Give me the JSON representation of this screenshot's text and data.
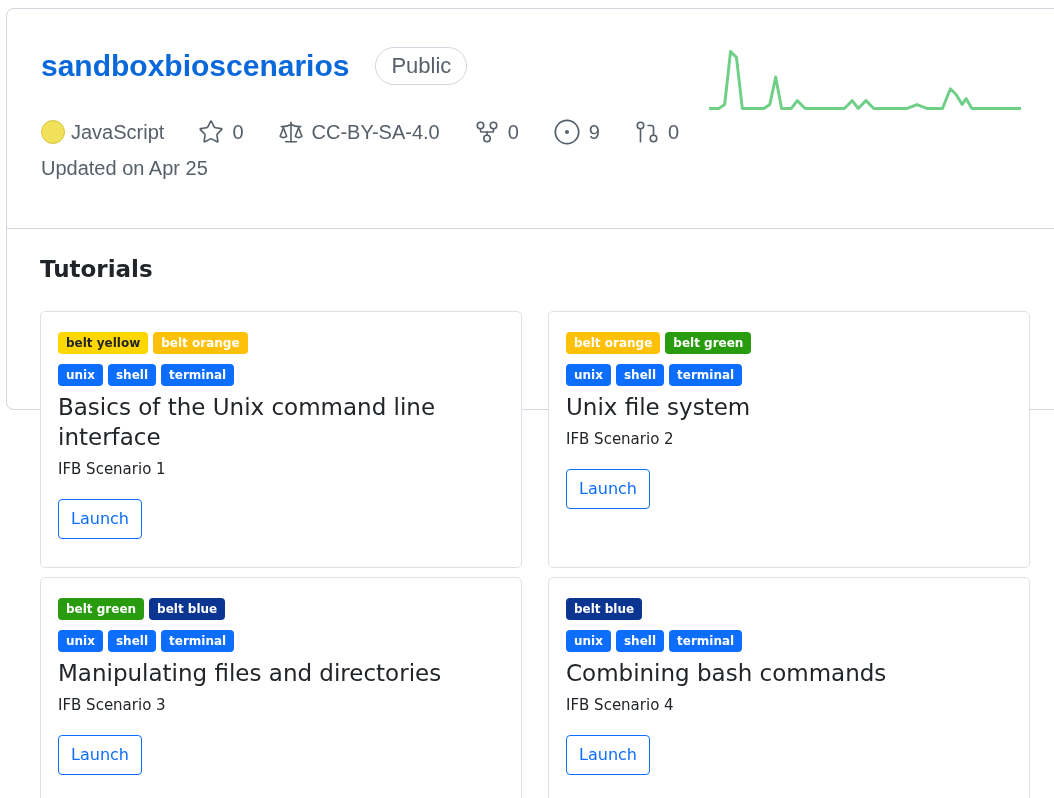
{
  "repo": {
    "name": "sandboxbioscenarios",
    "visibility": "Public",
    "language": {
      "name": "JavaScript",
      "color": "#f1e05a"
    },
    "stars": "0",
    "license": "CC-BY-SA-4.0",
    "forks": "0",
    "issues": "9",
    "pull_requests": "0",
    "updated": "Updated on Apr 25"
  },
  "tutorials": {
    "heading": "Tutorials",
    "cards": [
      {
        "tags": [
          [
            {
              "label": "belt yellow",
              "color": "#ffd700",
              "kind": "dark"
            },
            {
              "label": "belt orange",
              "color": "#ffc107",
              "kind": "light"
            }
          ],
          [
            {
              "label": "unix",
              "color": "#0d6efd",
              "kind": "light"
            },
            {
              "label": "shell",
              "color": "#0d6efd",
              "kind": "light"
            },
            {
              "label": "terminal",
              "color": "#0d6efd",
              "kind": "light"
            }
          ]
        ],
        "title": "Basics of the Unix command line interface",
        "subtitle": "IFB Scenario 1",
        "button": "Launch"
      },
      {
        "tags": [
          [
            {
              "label": "belt orange",
              "color": "#ffc107",
              "kind": "light"
            },
            {
              "label": "belt green",
              "color": "#289c0e",
              "kind": "light"
            }
          ],
          [
            {
              "label": "unix",
              "color": "#0d6efd",
              "kind": "light"
            },
            {
              "label": "shell",
              "color": "#0d6efd",
              "kind": "light"
            },
            {
              "label": "terminal",
              "color": "#0d6efd",
              "kind": "light"
            }
          ]
        ],
        "title": "Unix file system",
        "subtitle": "IFB Scenario 2",
        "button": "Launch"
      },
      {
        "tags": [
          [
            {
              "label": "belt green",
              "color": "#289c0e",
              "kind": "light"
            },
            {
              "label": "belt blue",
              "color": "#0b3591",
              "kind": "light"
            }
          ],
          [
            {
              "label": "unix",
              "color": "#0d6efd",
              "kind": "light"
            },
            {
              "label": "shell",
              "color": "#0d6efd",
              "kind": "light"
            },
            {
              "label": "terminal",
              "color": "#0d6efd",
              "kind": "light"
            }
          ]
        ],
        "title": "Manipulating files and directories",
        "subtitle": "IFB Scenario 3",
        "button": "Launch"
      },
      {
        "tags": [
          [
            {
              "label": "belt blue",
              "color": "#0b3591",
              "kind": "light"
            }
          ],
          [
            {
              "label": "unix",
              "color": "#0d6efd",
              "kind": "light"
            },
            {
              "label": "shell",
              "color": "#0d6efd",
              "kind": "light"
            },
            {
              "label": "terminal",
              "color": "#0d6efd",
              "kind": "light"
            }
          ]
        ],
        "title": "Combining bash commands",
        "subtitle": "IFB Scenario 4",
        "button": "Launch"
      }
    ]
  }
}
